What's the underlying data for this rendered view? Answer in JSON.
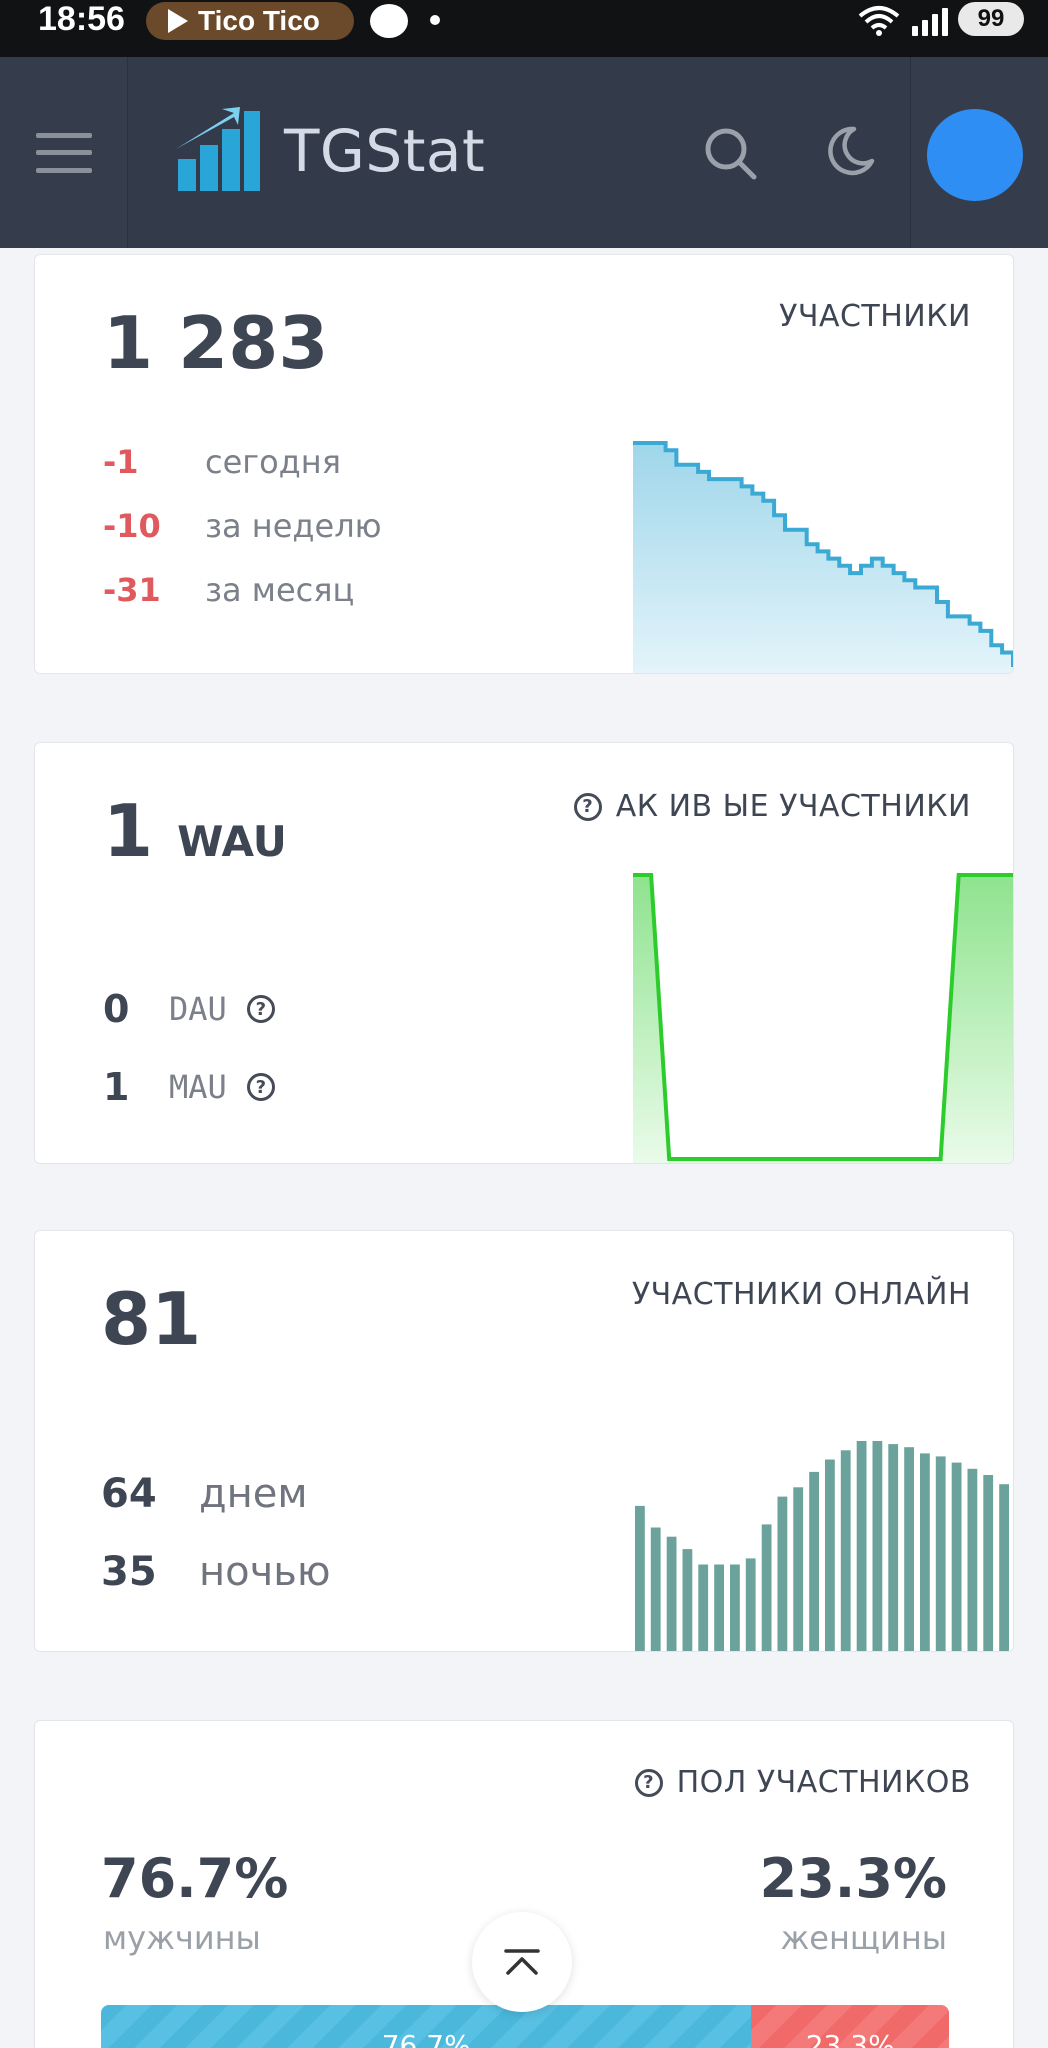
{
  "status_bar": {
    "time": "18:56",
    "media": "Tico Tico",
    "battery": "99",
    "icons": [
      "play-icon",
      "gamepad-icon",
      "wifi-icon",
      "signal-icon",
      "battery-icon"
    ]
  },
  "header": {
    "brand": "TGStat",
    "icons": [
      "menu-icon",
      "tgstat-logo",
      "search-icon",
      "moon-icon",
      "avatar"
    ],
    "accent": "#2aa5d8",
    "background": "#333a49"
  },
  "members": {
    "value": "1 283",
    "title": "УЧАСТНИКИ",
    "changes": [
      {
        "value": "-1",
        "label": "сегодня"
      },
      {
        "value": "-10",
        "label": "за неделю"
      },
      {
        "value": "-31",
        "label": "за месяц"
      }
    ],
    "color": "#3aa9d4"
  },
  "active": {
    "value": "1",
    "unit": "WAU",
    "title": "АК ИВ ЫЕ УЧАСТНИКИ",
    "rows": [
      {
        "value": "0",
        "label": "DAU"
      },
      {
        "value": "1",
        "label": "MAU"
      }
    ],
    "color": "#2ccc2c"
  },
  "online": {
    "value": "81",
    "title": "УЧАСТНИКИ ОНЛАЙН",
    "rows": [
      {
        "value": "64",
        "label": "днем"
      },
      {
        "value": "35",
        "label": "ночью"
      }
    ],
    "color": "#6ba39c"
  },
  "gender": {
    "title": "ПОЛ УЧАСТНИКОВ",
    "male_pct": "76.7%",
    "male_label": "мужчины",
    "female_pct": "23.3%",
    "female_label": "женщины",
    "male_share": 76.7,
    "female_share": 23.3,
    "male_color": "#4ab7db",
    "female_color": "#f06a69"
  },
  "chart_data": [
    {
      "type": "area",
      "series": [
        {
          "values": [
            1314,
            1314,
            1314,
            1313,
            1311,
            1311,
            1310,
            1309,
            1309,
            1309,
            1308,
            1307,
            1306,
            1304,
            1302,
            1302,
            1300,
            1299,
            1298,
            1297,
            1296,
            1297,
            1298,
            1297,
            1296,
            1295,
            1294,
            1294,
            1292,
            1290,
            1290,
            1289,
            1288,
            1286,
            1285,
            1283
          ]
        }
      ]
    },
    {
      "type": "area",
      "series": [
        {
          "values": [
            1,
            1,
            0,
            0,
            0,
            0,
            0,
            0,
            0,
            0,
            0,
            0,
            0,
            0,
            0,
            0,
            0,
            0,
            1,
            1,
            1,
            1
          ]
        }
      ]
    },
    {
      "type": "bar",
      "series": [
        {
          "values": [
            47,
            40,
            37,
            33,
            28,
            28,
            28,
            30,
            41,
            50,
            53,
            58,
            62,
            65,
            68,
            68,
            67,
            66,
            64,
            63,
            61,
            59,
            57,
            54
          ]
        }
      ]
    }
  ]
}
